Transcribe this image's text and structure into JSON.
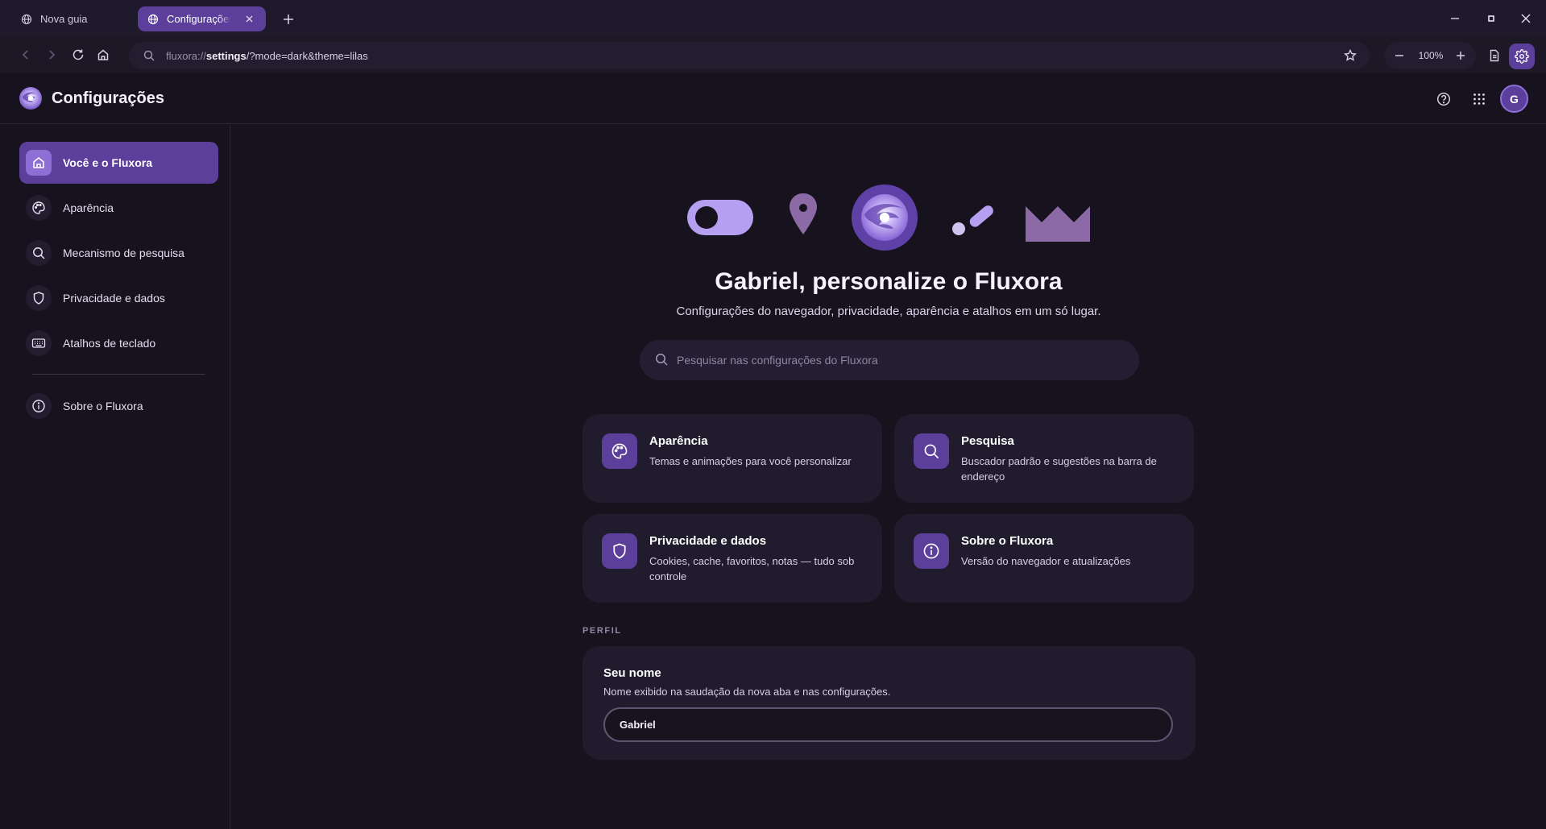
{
  "tabs": [
    {
      "label": "Nova guia",
      "active": false
    },
    {
      "label": "Configurações",
      "active": true
    }
  ],
  "toolbar": {
    "url_scheme": "fluxora://",
    "url_host": "settings",
    "url_rest": "/?mode=dark&theme=lilas",
    "zoom": "100%"
  },
  "header": {
    "title": "Configurações",
    "avatar_initial": "G"
  },
  "sidebar": {
    "items": [
      {
        "label": "Você e o Fluxora",
        "icon": "home-icon",
        "active": true
      },
      {
        "label": "Aparência",
        "icon": "palette-icon",
        "active": false
      },
      {
        "label": "Mecanismo de pesquisa",
        "icon": "search-icon",
        "active": false
      },
      {
        "label": "Privacidade e dados",
        "icon": "shield-icon",
        "active": false
      },
      {
        "label": "Atalhos de teclado",
        "icon": "keyboard-icon",
        "active": false
      },
      {
        "label": "Sobre o Fluxora",
        "icon": "info-icon",
        "active": false
      }
    ]
  },
  "main": {
    "headline": "Gabriel, personalize o Fluxora",
    "subline": "Configurações do navegador, privacidade, aparência e atalhos em um só lugar.",
    "search_placeholder": "Pesquisar nas configurações do Fluxora",
    "cards": [
      {
        "title": "Aparência",
        "desc": "Temas e animações para você personalizar",
        "icon": "palette-icon"
      },
      {
        "title": "Pesquisa",
        "desc": "Buscador padrão e sugestões na barra de endereço",
        "icon": "search-icon"
      },
      {
        "title": "Privacidade e dados",
        "desc": "Cookies, cache, favoritos, notas — tudo sob controle",
        "icon": "shield-icon"
      },
      {
        "title": "Sobre o Fluxora",
        "desc": "Versão do navegador e atualizações",
        "icon": "info-icon"
      }
    ],
    "profile": {
      "section_label": "PERFIL",
      "title": "Seu nome",
      "desc": "Nome exibido na saudação da nova aba e nas configurações.",
      "name_value": "Gabriel"
    }
  },
  "colors": {
    "accent": "#5b3f9a",
    "accent_light": "#8d6fd6",
    "background": "#16131f",
    "card": "#211c2d"
  }
}
